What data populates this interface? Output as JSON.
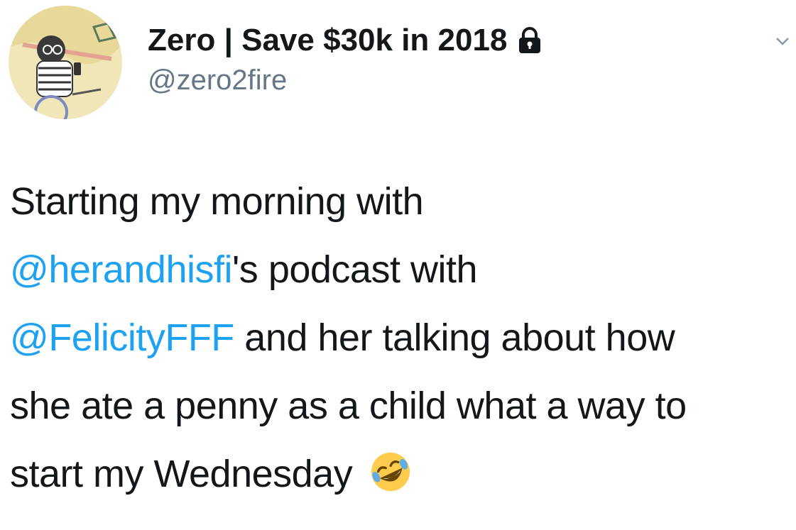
{
  "author": {
    "display_name": "Zero | Save $30k in 2018",
    "handle": "@zero2fire",
    "avatar_icon": "illustrated-woman-avatar",
    "protected_icon": "lock-icon"
  },
  "menu": {
    "icon": "chevron-down-icon"
  },
  "tweet": {
    "line1": "Starting my morning with",
    "mention1": "@herandhisfi",
    "line2_rest": "'s podcast with",
    "mention2": "@FelicityFFF",
    "line3_rest": " and her talking about how",
    "line4": "she ate a penny as a child what a way to",
    "line5": "start my Wednesday",
    "emoji": "rolling-on-floor-laughing-emoji"
  },
  "colors": {
    "mention": "#1da1f2",
    "text": "#14171a",
    "secondary": "#657786"
  }
}
